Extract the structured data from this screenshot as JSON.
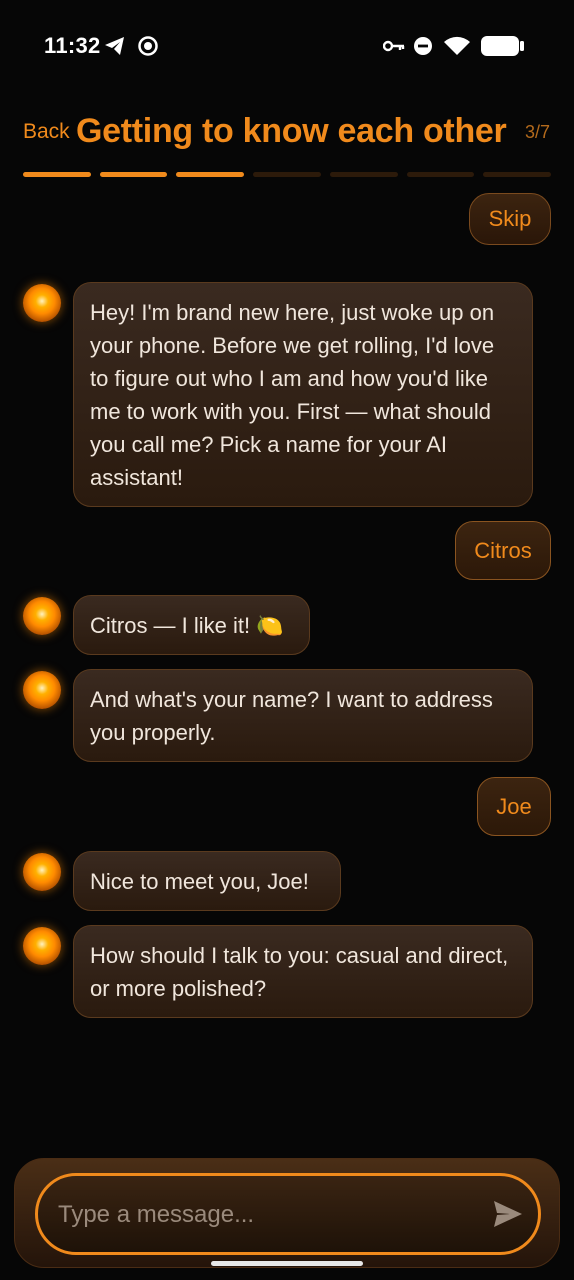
{
  "status": {
    "time": "11:32"
  },
  "header": {
    "back_label": "Back",
    "title": "Getting to know each other",
    "step": "3/7",
    "progress": {
      "current": 3,
      "total": 7
    }
  },
  "skip_label": "Skip",
  "messages": [
    {
      "from": "assistant",
      "text": "Hey! I'm brand new here, just woke up on your phone. Before we get rolling, I'd love to figure out who I am and how you'd like me to work with you. First — what should you call me? Pick a name for your AI assistant!"
    },
    {
      "from": "user",
      "text": "Citros"
    },
    {
      "from": "assistant",
      "text": "Citros — I like it! 🍋"
    },
    {
      "from": "assistant",
      "text": "And what's your name? I want to address you properly."
    },
    {
      "from": "user",
      "text": "Joe"
    },
    {
      "from": "assistant",
      "text": "Nice to meet you, Joe!"
    },
    {
      "from": "assistant",
      "text": "How should I talk to you: casual and direct, or more polished?"
    }
  ],
  "composer": {
    "placeholder": "Type a message..."
  },
  "colors": {
    "accent": "#f08a1c",
    "background": "#060606"
  },
  "icons": [
    "telegram-icon",
    "record-icon",
    "key-icon",
    "do-not-disturb-icon",
    "wifi-icon",
    "battery-icon",
    "send-icon"
  ]
}
